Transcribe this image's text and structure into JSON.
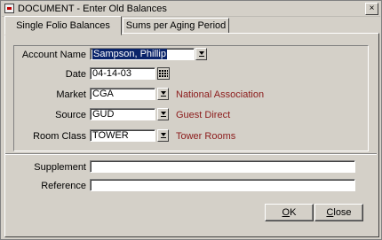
{
  "window": {
    "title": "DOCUMENT - Enter Old Balances",
    "close_glyph": "×"
  },
  "tabs": [
    {
      "label": "Single Folio Balances",
      "active": true
    },
    {
      "label": "Sums per Aging Period",
      "active": false
    }
  ],
  "form": {
    "account_name": {
      "label": "Account Name",
      "value": "Sampson, Phillip"
    },
    "date": {
      "label": "Date",
      "value": "04-14-03"
    },
    "market": {
      "label": "Market",
      "value": "CGA",
      "description": "National Association"
    },
    "source": {
      "label": "Source",
      "value": "GUD",
      "description": "Guest Direct"
    },
    "room_class": {
      "label": "Room Class",
      "value": "TOWER",
      "description": "Tower Rooms"
    },
    "supplement": {
      "label": "Supplement",
      "value": ""
    },
    "reference": {
      "label": "Reference",
      "value": ""
    }
  },
  "buttons": {
    "ok": {
      "mnemonic": "O",
      "rest": "K"
    },
    "close": {
      "mnemonic": "C",
      "rest": "lose"
    }
  },
  "colors": {
    "description_text": "#8b1a1a",
    "selection": "#0a246a",
    "face": "#d4d0c8"
  },
  "icons": [
    "app-icon",
    "dropdown-arrow-icon",
    "calendar-icon",
    "close-icon"
  ]
}
